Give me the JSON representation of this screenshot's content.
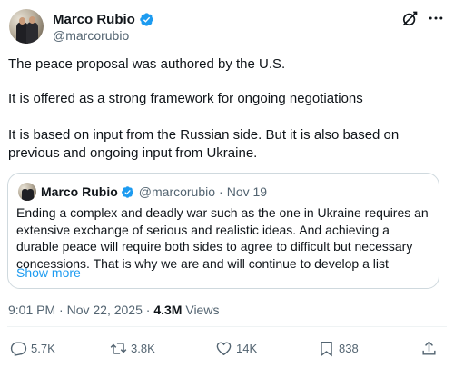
{
  "author": {
    "display_name": "Marco Rubio",
    "handle": "@marcorubio",
    "verified_color": "#1d9bf0"
  },
  "header_icons": [
    "grok-icon",
    "more-icon"
  ],
  "tweet": {
    "paragraphs": [
      "The peace proposal was authored by the U.S.",
      "It is offered as a strong framework for ongoing negotiations",
      "It is based on input from the Russian side. But it is also based on previous and ongoing input from Ukraine."
    ],
    "time": "9:01 PM",
    "date": "Nov 22, 2025",
    "views_count": "4.3M",
    "views_label": "Views"
  },
  "quoted_tweet": {
    "display_name": "Marco Rubio",
    "handle": "@marcorubio",
    "separator": "·",
    "date": "Nov 19",
    "text": "Ending a complex and deadly war such as the one in Ukraine requires an extensive exchange of serious and realistic ideas. And achieving a durable peace will require both sides to agree to difficult but necessary concessions. That is why we are and will continue to develop a list",
    "show_more": "Show more"
  },
  "actions": {
    "replies": "5.7K",
    "reposts": "3.8K",
    "likes": "14K",
    "bookmarks": "838"
  },
  "colors": {
    "text": "#0f1419",
    "secondary": "#536471",
    "accent": "#1d9bf0",
    "border": "#cfd9de"
  }
}
